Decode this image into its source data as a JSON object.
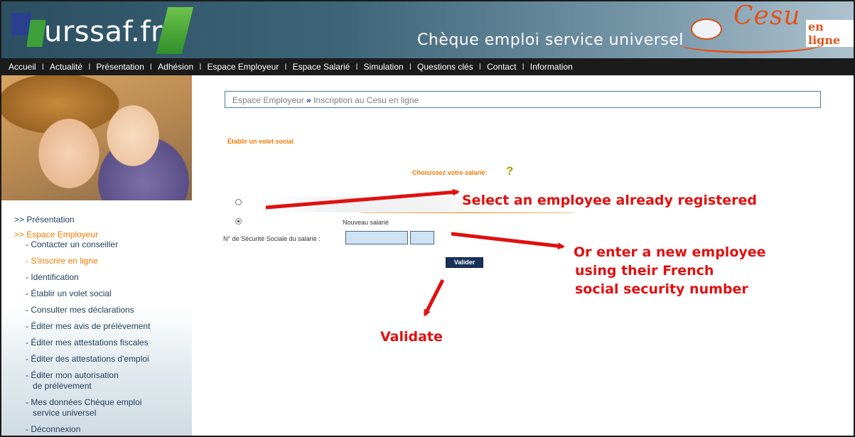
{
  "header": {
    "logo_text": "urssaf.fr",
    "subtitle": "Chèque emploi service universel",
    "brand": "Cesu",
    "brand_suffix": "en ligne"
  },
  "nav": [
    {
      "label": "Accueil"
    },
    {
      "label": "Actualité"
    },
    {
      "label": "Présentation"
    },
    {
      "label": "Adhésion"
    },
    {
      "label": "Espace Employeur"
    },
    {
      "label": "Espace Salarié"
    },
    {
      "label": "Simulation"
    },
    {
      "label": "Questions clés"
    },
    {
      "label": "Contact"
    },
    {
      "label": "Information"
    }
  ],
  "sidebar": {
    "presentation": ">> Présentation",
    "espace_employeur": ">> Espace Employeur",
    "items": [
      "- Contacter un conseiller",
      "- S'inscrire en ligne",
      "- Identification",
      "- Établir un volet social",
      "- Consulter mes déclarations",
      "- Éditer mes avis de prélèvement",
      "- Éditer mes attestations fiscales",
      "- Éditer des attestations d'emploi",
      "- Éditer mon autorisation",
      "de prélèvement",
      "- Mes données Chèque emploi",
      "service universel",
      "- Déconnexion"
    ]
  },
  "breadcrumb": {
    "parent": "Espace Employeur",
    "separator": "»",
    "current": "Inscription au Cesu en ligne"
  },
  "form": {
    "section_title": "Établir un volet social",
    "choose_label": "Choisissez votre salarié:",
    "help": "?",
    "new_employee_label": "Nouveau salarié",
    "ssn_label": "N° de Sécurité Sociale du salarié :",
    "ssn_value_1": "",
    "ssn_value_2": "",
    "validate_label": "Valider"
  },
  "annotations": {
    "select_existing": "Select an employee already registered",
    "new_line_1": "Or enter a new employee",
    "new_line_2": "using their French",
    "new_line_3": "social security number",
    "validate": "Validate"
  },
  "colors": {
    "accent_orange": "#f07a00",
    "annotation_red": "#e01010",
    "nav_bg": "#1b1b1b",
    "button_navy": "#18305a"
  }
}
